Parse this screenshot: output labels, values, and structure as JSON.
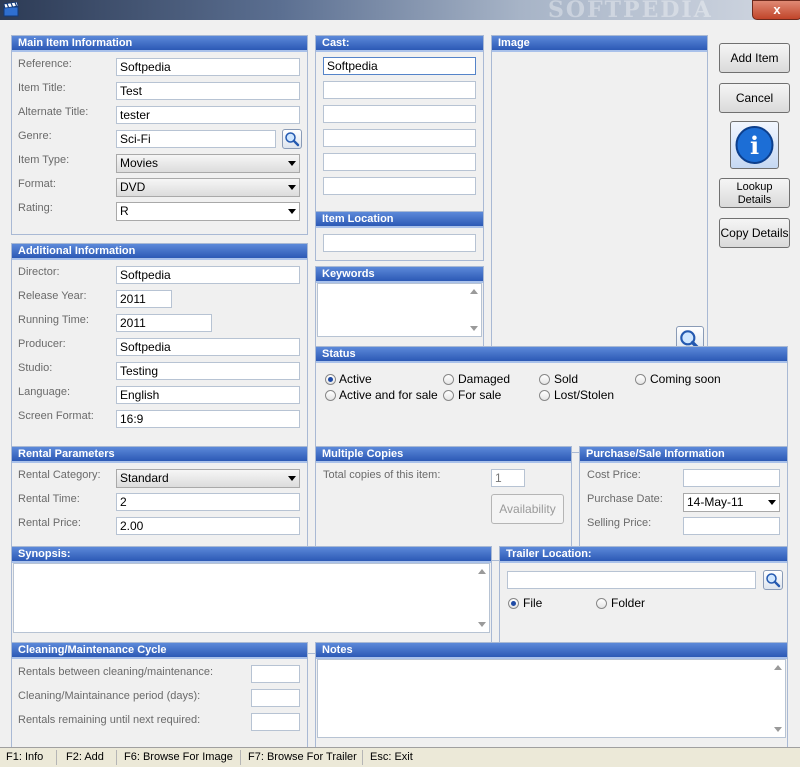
{
  "window": {
    "watermark": "SOFTPEDIA",
    "close_label": "x"
  },
  "main_item": {
    "title": "Main Item Information",
    "reference": {
      "label": "Reference:",
      "value": "Softpedia"
    },
    "item_title": {
      "label": "Item Title:",
      "value": "Test"
    },
    "alt_title": {
      "label": "Alternate Title:",
      "value": "tester"
    },
    "genre": {
      "label": "Genre:",
      "value": "Sci-Fi"
    },
    "item_type": {
      "label": "Item Type:",
      "value": "Movies"
    },
    "format": {
      "label": "Format:",
      "value": "DVD"
    },
    "rating": {
      "label": "Rating:",
      "value": "R"
    }
  },
  "additional": {
    "title": "Additional Information",
    "director": {
      "label": "Director:",
      "value": "Softpedia"
    },
    "release_year": {
      "label": "Release Year:",
      "value": "2011"
    },
    "running_time": {
      "label": "Running Time:",
      "value": "2011"
    },
    "producer": {
      "label": "Producer:",
      "value": "Softpedia"
    },
    "studio": {
      "label": "Studio:",
      "value": "Testing"
    },
    "language": {
      "label": "Language:",
      "value": "English"
    },
    "screen_format": {
      "label": "Screen Format:",
      "value": "16:9"
    }
  },
  "cast": {
    "title": "Cast:",
    "values": [
      "Softpedia",
      "",
      "",
      "",
      "",
      ""
    ]
  },
  "item_location": {
    "title": "Item Location",
    "value": ""
  },
  "keywords": {
    "title": "Keywords"
  },
  "image": {
    "title": "Image"
  },
  "buttons": {
    "add_item": "Add Item",
    "cancel": "Cancel",
    "lookup_details": "Lookup\nDetails",
    "copy_details": "Copy Details",
    "info_glyph": "i"
  },
  "status": {
    "title": "Status",
    "options": [
      {
        "label": "Active",
        "checked": true
      },
      {
        "label": "Damaged",
        "checked": false
      },
      {
        "label": "Sold",
        "checked": false
      },
      {
        "label": "Coming soon",
        "checked": false
      },
      {
        "label": "Active and for sale",
        "checked": false
      },
      {
        "label": "For sale",
        "checked": false
      },
      {
        "label": "Lost/Stolen",
        "checked": false
      }
    ]
  },
  "rental": {
    "title": "Rental Parameters",
    "category": {
      "label": "Rental Category:",
      "value": "Standard"
    },
    "time": {
      "label": "Rental Time:",
      "value": "2"
    },
    "price": {
      "label": "Rental Price:",
      "value": "2.00"
    }
  },
  "multiple_copies": {
    "title": "Multiple Copies",
    "total_label": "Total copies of this item:",
    "total_value": "1",
    "availability": "Availability"
  },
  "purchase": {
    "title": "Purchase/Sale Information",
    "cost": {
      "label": "Cost Price:",
      "value": ""
    },
    "date": {
      "label": "Purchase Date:",
      "value": "14-May-11"
    },
    "selling": {
      "label": "Selling Price:",
      "value": ""
    }
  },
  "synopsis": {
    "title": "Synopsis:"
  },
  "trailer": {
    "title": "Trailer Location:",
    "value": "",
    "file": "File",
    "folder": "Folder"
  },
  "cleaning": {
    "title": "Cleaning/Maintenance Cycle",
    "between": "Rentals between cleaning/maintenance:",
    "period": "Cleaning/Maintainance period (days):",
    "remaining": "Rentals remaining until next required:"
  },
  "notes": {
    "title": "Notes"
  },
  "statusbar": [
    "F1: Info",
    "F2: Add",
    "F6: Browse For Image",
    "F7: Browse For Trailer",
    "Esc: Exit"
  ],
  "colors": {
    "header_top": "#5c89d9",
    "header_bottom": "#2c59b5",
    "panel": "#f0f0f0"
  }
}
